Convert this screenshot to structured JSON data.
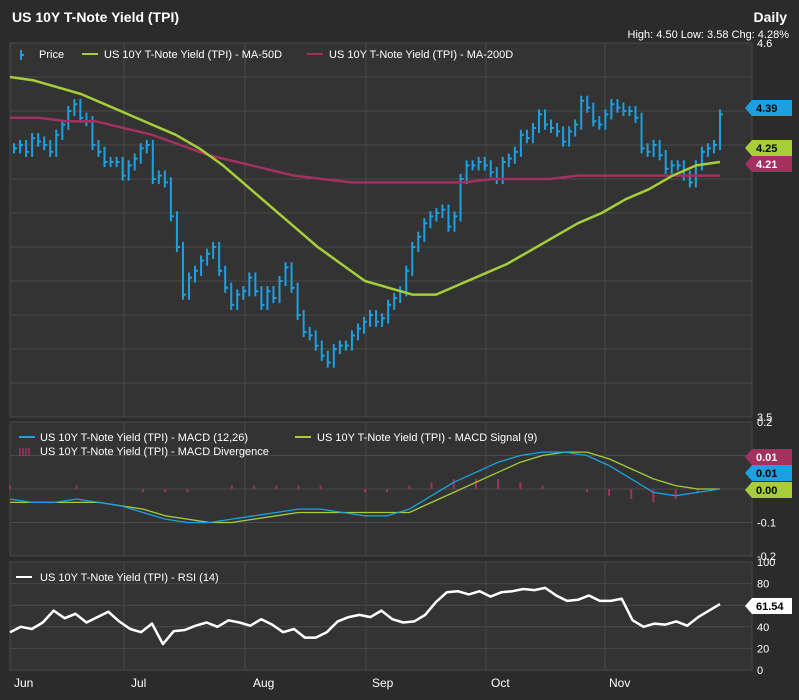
{
  "header": {
    "title": "US 10Y T-Note Yield (TPI)",
    "period": "Daily",
    "stats": "High: 4.50 Low: 3.58 Chg: 4.28%"
  },
  "colors": {
    "background": "#2b2b2b",
    "panel": "#333333",
    "grid": "#4a4a4a",
    "price": "#1ba1e2",
    "ma50": "#a6ce39",
    "ma200": "#a3305f",
    "macd": "#1ba1e2",
    "signal": "#a6ce39",
    "divergence": "#a3305f",
    "rsi": "#ffffff"
  },
  "chart_data": [
    {
      "type": "line",
      "panel": "price",
      "scale": "yield",
      "x": [
        "Jun",
        "Jul",
        "Aug",
        "Sep",
        "Oct",
        "Nov"
      ],
      "ylim": [
        3.5,
        4.6
      ],
      "yticks": [
        "4.6",
        "3.5"
      ],
      "legend": [
        "Price",
        "US 10Y T-Note Yield (TPI) - MA-50D",
        "US 10Y T-Note Yield (TPI) - MA-200D"
      ],
      "series": [
        {
          "name": "Price",
          "style": "hlc-bars",
          "values": [
            4.29,
            4.3,
            4.28,
            4.32,
            4.31,
            4.3,
            4.28,
            4.33,
            4.36,
            4.4,
            4.42,
            4.38,
            4.37,
            4.3,
            4.28,
            4.25,
            4.25,
            4.25,
            4.21,
            4.24,
            4.26,
            4.29,
            4.3,
            4.2,
            4.21,
            4.19,
            4.09,
            4.0,
            3.86,
            3.91,
            3.93,
            3.96,
            3.98,
            4.0,
            3.93,
            3.88,
            3.83,
            3.86,
            3.87,
            3.91,
            3.87,
            3.83,
            3.87,
            3.85,
            3.9,
            3.94,
            3.88,
            3.8,
            3.75,
            3.74,
            3.71,
            3.68,
            3.66,
            3.7,
            3.71,
            3.71,
            3.74,
            3.76,
            3.78,
            3.8,
            3.78,
            3.79,
            3.83,
            3.85,
            3.87,
            3.93,
            4.0,
            4.03,
            4.07,
            4.09,
            4.1,
            4.11,
            4.06,
            4.09,
            4.2,
            4.24,
            4.24,
            4.25,
            4.24,
            4.22,
            4.2,
            4.25,
            4.26,
            4.28,
            4.33,
            4.32,
            4.35,
            4.39,
            4.36,
            4.35,
            4.34,
            4.31,
            4.34,
            4.36,
            4.43,
            4.41,
            4.37,
            4.36,
            4.39,
            4.42,
            4.41,
            4.4,
            4.4,
            4.38,
            4.29,
            4.28,
            4.3,
            4.27,
            4.23,
            4.24,
            4.24,
            4.21,
            4.19,
            4.24,
            4.28,
            4.29,
            4.3,
            4.39
          ],
          "last": "4.39"
        },
        {
          "name": "US 10Y T-Note Yield (TPI) - MA-50D",
          "values": [
            4.5,
            4.49,
            4.47,
            4.45,
            4.42,
            4.39,
            4.36,
            4.33,
            4.29,
            4.24,
            4.18,
            4.12,
            4.06,
            4.0,
            3.95,
            3.9,
            3.88,
            3.86,
            3.86,
            3.89,
            3.92,
            3.95,
            3.99,
            4.03,
            4.07,
            4.1,
            4.14,
            4.17,
            4.21,
            4.24,
            4.25
          ],
          "last": "4.25"
        },
        {
          "name": "US 10Y T-Note Yield (TPI) - MA-200D",
          "values": [
            4.38,
            4.38,
            4.37,
            4.37,
            4.35,
            4.33,
            4.3,
            4.27,
            4.25,
            4.23,
            4.21,
            4.2,
            4.19,
            4.19,
            4.19,
            4.19,
            4.19,
            4.2,
            4.2,
            4.2,
            4.21,
            4.21,
            4.21,
            4.21,
            4.21,
            4.21
          ],
          "last": "4.21"
        }
      ]
    },
    {
      "type": "line",
      "panel": "macd",
      "x": [
        "Jun",
        "Jul",
        "Aug",
        "Sep",
        "Oct",
        "Nov"
      ],
      "ylim": [
        -0.2,
        0.2
      ],
      "yticks": [
        "0.2",
        "0.1",
        "0.0",
        "-0.1",
        "-0.2"
      ],
      "legend": [
        "US 10Y T-Note Yield (TPI) - MACD (12,26)",
        "US 10Y T-Note Yield (TPI) - MACD Signal (9)",
        "US 10Y T-Note Yield (TPI) - MACD Divergence"
      ],
      "series": [
        {
          "name": "US 10Y T-Note Yield (TPI) - MACD (12,26)",
          "values": [
            -0.03,
            -0.04,
            -0.04,
            -0.03,
            -0.04,
            -0.05,
            -0.07,
            -0.09,
            -0.1,
            -0.1,
            -0.09,
            -0.08,
            -0.07,
            -0.06,
            -0.06,
            -0.07,
            -0.08,
            -0.08,
            -0.06,
            -0.02,
            0.02,
            0.05,
            0.08,
            0.1,
            0.11,
            0.11,
            0.1,
            0.07,
            0.03,
            -0.01,
            -0.02,
            -0.01,
            0.0
          ],
          "last": "0.01"
        },
        {
          "name": "US 10Y T-Note Yield (TPI) - MACD Signal (9)",
          "values": [
            -0.04,
            -0.04,
            -0.04,
            -0.04,
            -0.04,
            -0.05,
            -0.06,
            -0.08,
            -0.09,
            -0.1,
            -0.1,
            -0.09,
            -0.08,
            -0.07,
            -0.07,
            -0.07,
            -0.07,
            -0.07,
            -0.07,
            -0.04,
            -0.01,
            0.02,
            0.05,
            0.08,
            0.1,
            0.11,
            0.11,
            0.09,
            0.06,
            0.03,
            0.01,
            0.0,
            0.0
          ],
          "last": "0.00"
        },
        {
          "name": "US 10Y T-Note Yield (TPI) - MACD Divergence",
          "style": "histogram",
          "values": [
            0.01,
            0.0,
            0.0,
            0.01,
            0.0,
            0.0,
            -0.01,
            -0.01,
            -0.01,
            0.0,
            0.01,
            0.01,
            0.01,
            0.01,
            0.01,
            0.0,
            -0.01,
            -0.01,
            0.01,
            0.02,
            0.03,
            0.03,
            0.03,
            0.02,
            0.01,
            0.0,
            -0.01,
            -0.02,
            -0.03,
            -0.04,
            -0.03,
            -0.01,
            0.0
          ],
          "last": "0.01"
        }
      ]
    },
    {
      "type": "line",
      "panel": "rsi",
      "x": [
        "Jun",
        "Jul",
        "Aug",
        "Sep",
        "Oct",
        "Nov"
      ],
      "ylim": [
        0,
        100
      ],
      "yticks": [
        "100",
        "80",
        "60",
        "40",
        "20",
        "0"
      ],
      "legend": [
        "US 10Y T-Note Yield (TPI) - RSI (14)"
      ],
      "series": [
        {
          "name": "US 10Y T-Note Yield (TPI) - RSI (14)",
          "values": [
            35,
            40,
            38,
            44,
            55,
            48,
            52,
            44,
            49,
            54,
            45,
            38,
            35,
            43,
            24,
            36,
            37,
            41,
            44,
            40,
            46,
            44,
            41,
            47,
            42,
            35,
            38,
            30,
            30,
            35,
            45,
            49,
            51,
            49,
            55,
            47,
            44,
            45,
            51,
            63,
            72,
            73,
            70,
            73,
            68,
            72,
            73,
            75,
            74,
            76,
            69,
            64,
            65,
            69,
            64,
            64,
            66,
            46,
            40,
            43,
            42,
            45,
            41,
            49,
            55,
            61
          ],
          "last": "61.54"
        }
      ]
    }
  ]
}
